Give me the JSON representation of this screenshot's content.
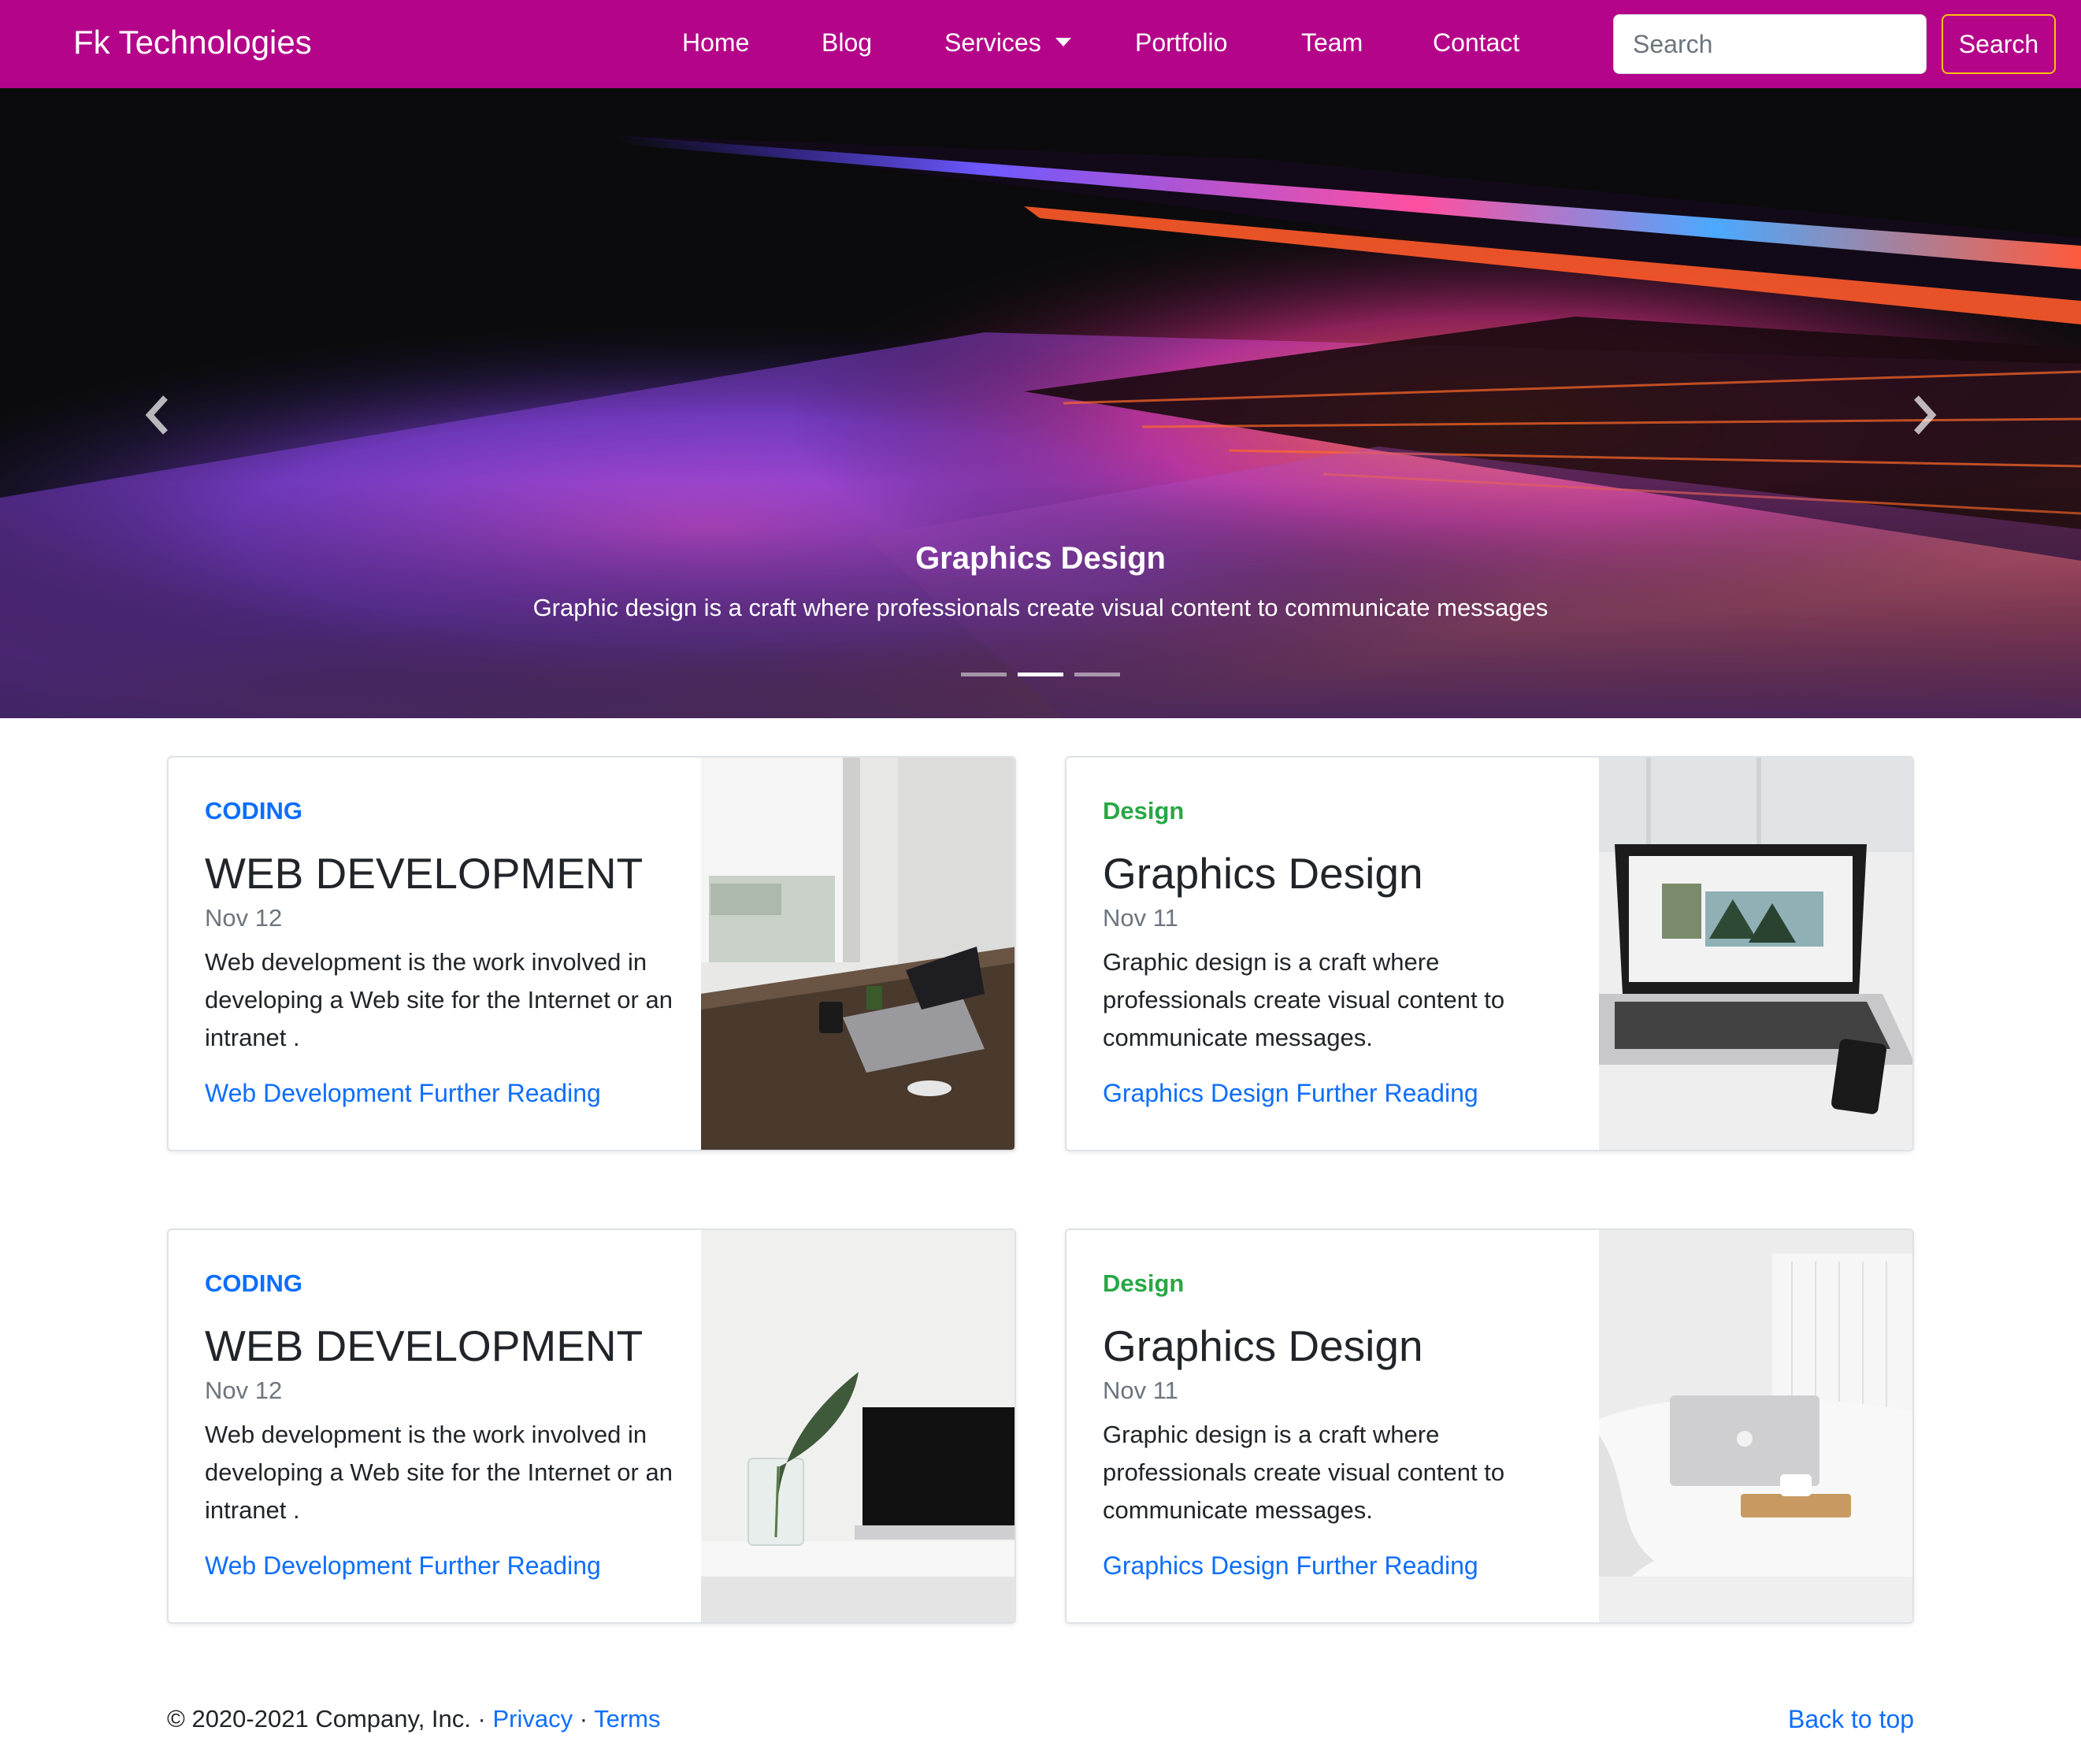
{
  "navbar": {
    "brand": "Fk Technologies",
    "links": [
      "Home",
      "Blog",
      "Services",
      "Portfolio",
      "Team",
      "Contact"
    ],
    "search_placeholder": "Search",
    "search_button": "Search",
    "background_color": "#b4048a"
  },
  "hero": {
    "caption_title": "Graphics Design",
    "caption_text": "Graphic design is a craft where professionals create visual content to communicate messages",
    "indicator_count": 3,
    "active_indicator": 2,
    "prev_icon": "chevron-left-icon",
    "next_icon": "chevron-right-icon"
  },
  "cards": [
    {
      "category": "CODING",
      "category_color": "#0d6efd",
      "title": "WEB DEVELOPMENT",
      "date": "Nov 12",
      "description": "Web development is the work involved in developing a Web site for the Internet or an intranet .",
      "link": "Web Development Further Reading"
    },
    {
      "category": "Design",
      "category_color": "#28a745",
      "title": "Graphics Design",
      "date": "Nov 11",
      "description": "Graphic design is a craft where professionals create visual content to communicate messages.",
      "link": "Graphics Design Further Reading"
    },
    {
      "category": "CODING",
      "category_color": "#0d6efd",
      "title": "WEB DEVELOPMENT",
      "date": "Nov 12",
      "description": "Web development is the work involved in developing a Web site for the Internet or an intranet .",
      "link": "Web Development Further Reading"
    },
    {
      "category": "Design",
      "category_color": "#28a745",
      "title": "Graphics Design",
      "date": "Nov 11",
      "description": "Graphic design is a craft where professionals create visual content to communicate messages.",
      "link": "Graphics Design Further Reading"
    }
  ],
  "footer": {
    "copyright": "© 2020-2021 Company, Inc. · ",
    "privacy": "Privacy",
    "separator": " · ",
    "terms": "Terms",
    "back_to_top": "Back to top"
  },
  "colors": {
    "link": "#0d6efd",
    "search_button_border": "#ffc107"
  }
}
